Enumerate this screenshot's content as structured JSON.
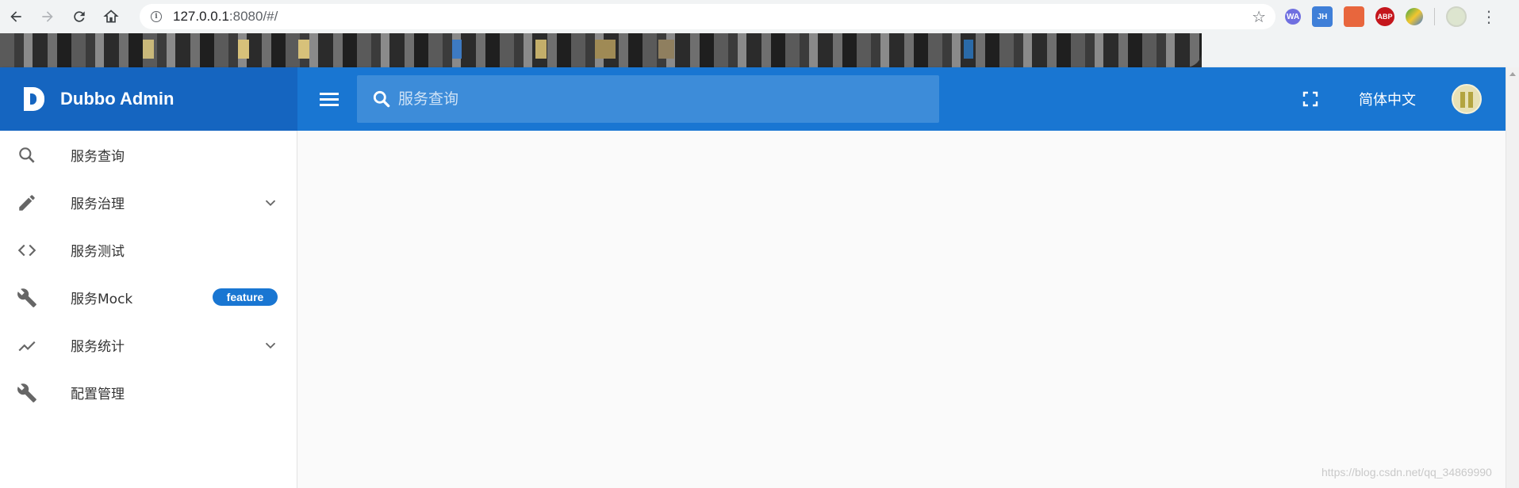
{
  "browser": {
    "url_host": "127.0.0.1",
    "url_rest": ":8080/#/",
    "extensions": [
      "WA",
      "JH",
      "",
      "ABP",
      ""
    ]
  },
  "header": {
    "brand_title": "Dubbo Admin",
    "search_placeholder": "服务查询",
    "language": "简体中文"
  },
  "sidebar": {
    "items": [
      {
        "label": "服务查询",
        "icon": "search-icon"
      },
      {
        "label": "服务治理",
        "icon": "pencil-icon",
        "expandable": true
      },
      {
        "label": "服务测试",
        "icon": "code-icon"
      },
      {
        "label": "服务Mock",
        "icon": "wrench-icon",
        "badge": "feature"
      },
      {
        "label": "服务统计",
        "icon": "trending-up-icon",
        "expandable": true
      },
      {
        "label": "配置管理",
        "icon": "wrench-icon"
      }
    ]
  },
  "watermark": "https://blog.csdn.net/qq_34869990",
  "colors": {
    "primary": "#1976d2",
    "primary_dark": "#1565c0",
    "background": "#fafafa"
  }
}
